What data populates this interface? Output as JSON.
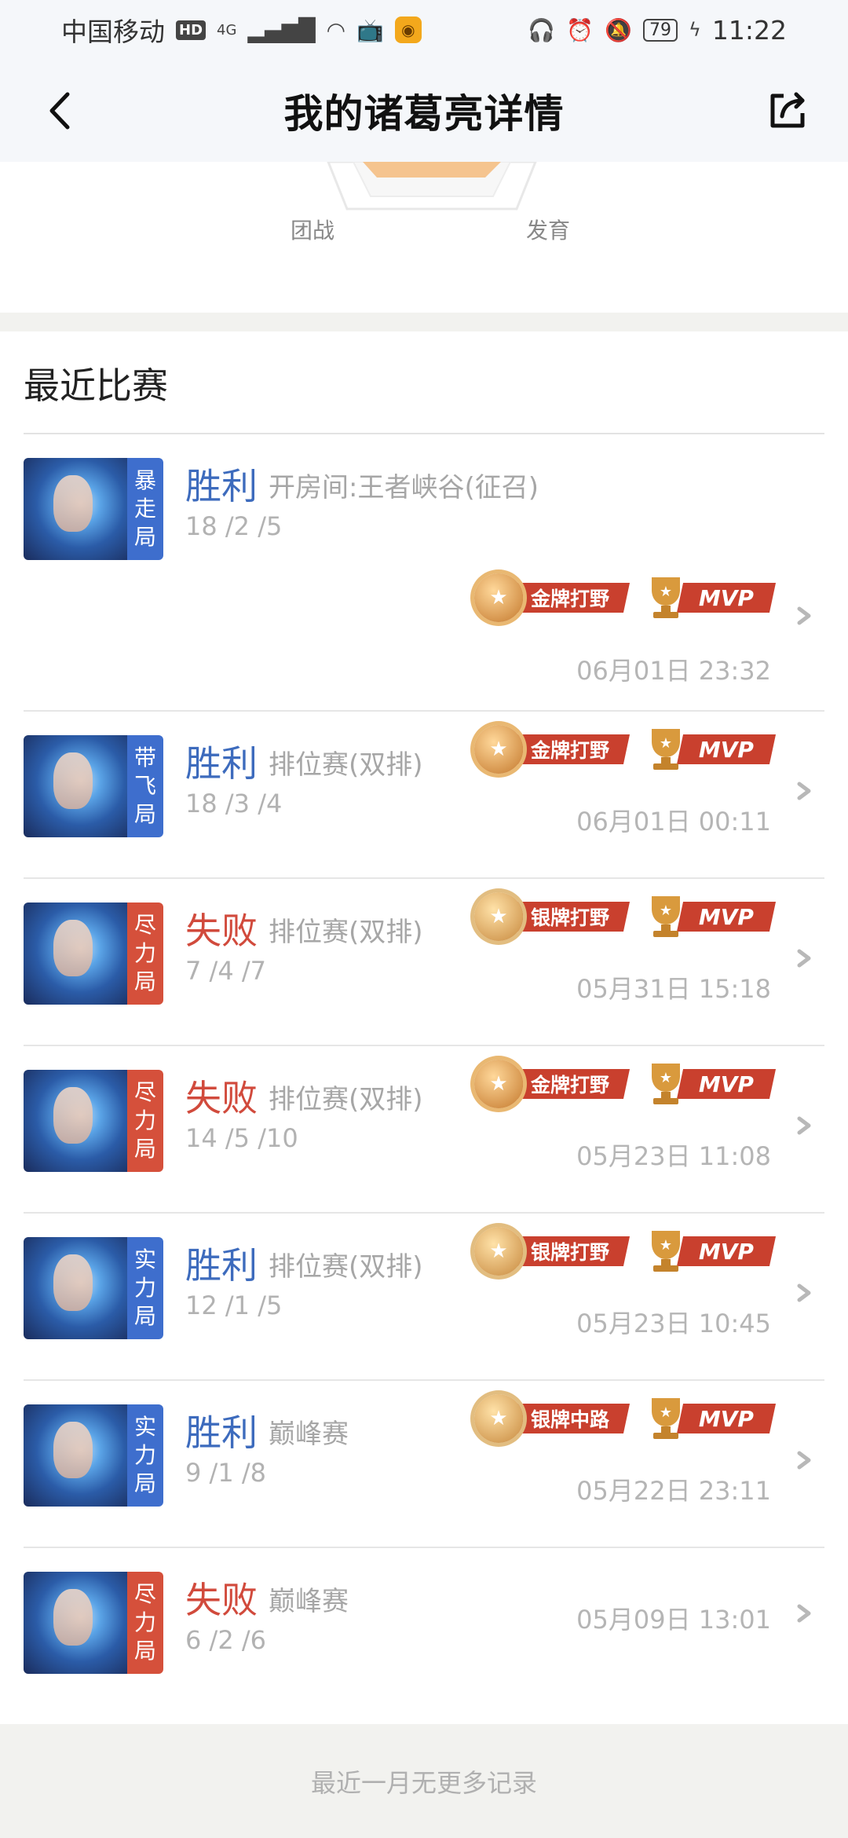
{
  "status_bar": {
    "carrier": "中国移动",
    "hd": "HD",
    "network": "4G",
    "battery": "79",
    "time": "11:22"
  },
  "nav": {
    "title": "我的诸葛亮详情",
    "back_icon": "chevron-left-icon",
    "share_icon": "share-icon"
  },
  "radar": {
    "label_left": "团战",
    "label_right": "发育",
    "fill_color": "#f5c48f"
  },
  "recent": {
    "title": "最近比赛"
  },
  "colors": {
    "win": "#3d6bbd",
    "loss": "#d14a3c",
    "tag_blue": "#3e6ecd",
    "tag_red": "#d5503b",
    "ribbon": "#c9402e"
  },
  "matches": [
    {
      "tag": "暴走局",
      "tag_color": "blue",
      "result": "胜利",
      "outcome": "win",
      "mode": "开房间:王者峡谷(征召)",
      "kda": "18 /2 /5",
      "date": "06月01日 23:32",
      "medal_type": "gold",
      "medal": "金牌打野",
      "mvp": "MVP"
    },
    {
      "tag": "带飞局",
      "tag_color": "blue",
      "result": "胜利",
      "outcome": "win",
      "mode": "排位赛(双排)",
      "kda": "18 /3 /4",
      "date": "06月01日 00:11",
      "medal_type": "gold",
      "medal": "金牌打野",
      "mvp": "MVP"
    },
    {
      "tag": "尽力局",
      "tag_color": "red",
      "result": "失败",
      "outcome": "loss",
      "mode": "排位赛(双排)",
      "kda": "7 /4 /7",
      "date": "05月31日 15:18",
      "medal_type": "silver",
      "medal": "银牌打野",
      "mvp": "MVP"
    },
    {
      "tag": "尽力局",
      "tag_color": "red",
      "result": "失败",
      "outcome": "loss",
      "mode": "排位赛(双排)",
      "kda": "14 /5 /10",
      "date": "05月23日 11:08",
      "medal_type": "gold",
      "medal": "金牌打野",
      "mvp": "MVP"
    },
    {
      "tag": "实力局",
      "tag_color": "blue",
      "result": "胜利",
      "outcome": "win",
      "mode": "排位赛(双排)",
      "kda": "12 /1 /5",
      "date": "05月23日 10:45",
      "medal_type": "silver",
      "medal": "银牌打野",
      "mvp": "MVP"
    },
    {
      "tag": "实力局",
      "tag_color": "blue",
      "result": "胜利",
      "outcome": "win",
      "mode": "巅峰赛",
      "kda": "9 /1 /8",
      "date": "05月22日 23:11",
      "medal_type": "silver",
      "medal": "银牌中路",
      "mvp": "MVP"
    },
    {
      "tag": "尽力局",
      "tag_color": "red",
      "result": "失败",
      "outcome": "loss",
      "mode": "巅峰赛",
      "kda": "6 /2 /6",
      "date": "05月09日 13:01",
      "medal_type": "",
      "medal": "",
      "mvp": ""
    }
  ],
  "footer": {
    "text": "最近一月无更多记录"
  }
}
